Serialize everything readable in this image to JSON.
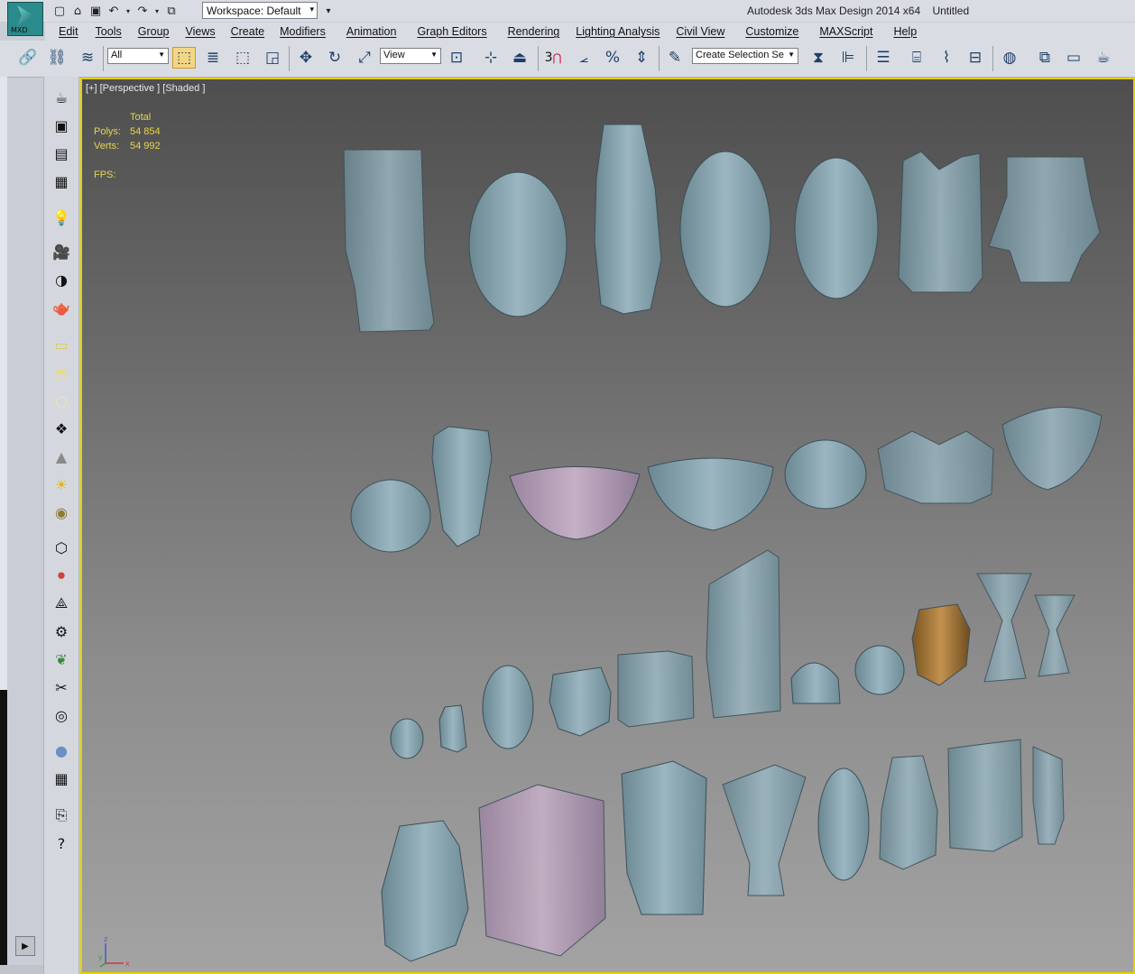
{
  "titlebar": {
    "app_label": "MXD",
    "workspace": "Workspace: Default",
    "app_title": "Autodesk 3ds Max Design 2014 x64",
    "doc_title": "Untitled"
  },
  "menu": [
    "Edit",
    "Tools",
    "Group",
    "Views",
    "Create",
    "Modifiers",
    "Animation",
    "Graph Editors",
    "Rendering",
    "Lighting Analysis",
    "Civil View",
    "Customize",
    "MAXScript",
    "Help"
  ],
  "toolbar": {
    "selection_filter": "All",
    "reference_coord": "View",
    "named_selection": "Create Selection Se",
    "snap_label": "3"
  },
  "viewport": {
    "label": "[+] [Perspective ] [Shaded ]",
    "stats": {
      "header": "Total",
      "polys_label": "Polys:",
      "polys_value": "54 854",
      "verts_label": "Verts:",
      "verts_value": "54 992",
      "fps_label": "FPS:"
    },
    "gizmo": {
      "z": "z",
      "y": "y",
      "x": "x"
    }
  },
  "colors": {
    "viewport_border": "#e3d000",
    "stats_text": "#e6d64a",
    "vase_glass": "#7f9eab",
    "vase_pink": "#b39bb4",
    "vase_bronze": "#a6783a"
  },
  "icons": {
    "quick_access": [
      "new-file-icon",
      "open-file-icon",
      "save-icon",
      "undo-icon",
      "redo-icon",
      "project-folder-icon"
    ],
    "command_panel": [
      "teapot-create-icon",
      "modify-icon",
      "hierarchy-icon",
      "motion-icon",
      "lightbulb-icon",
      "camera-icon",
      "render-icon",
      "teapot-render-icon"
    ]
  }
}
